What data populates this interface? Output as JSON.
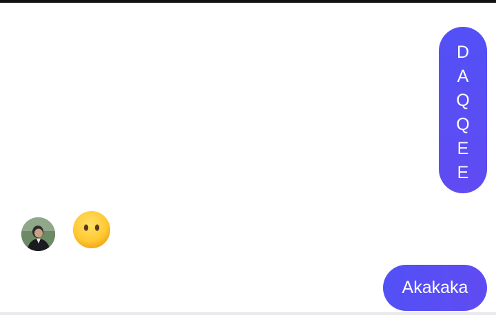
{
  "messages": {
    "outgoing_vertical": {
      "text": "DAQQEE",
      "chars": [
        "D",
        "A",
        "Q",
        "Q",
        "E",
        "E"
      ]
    },
    "incoming_emoji": {
      "emoji": "face-without-mouth"
    },
    "outgoing_last": {
      "text": "Akakaka"
    }
  },
  "colors": {
    "bubble": "#5650f5",
    "emoji": "#ffcc33"
  }
}
